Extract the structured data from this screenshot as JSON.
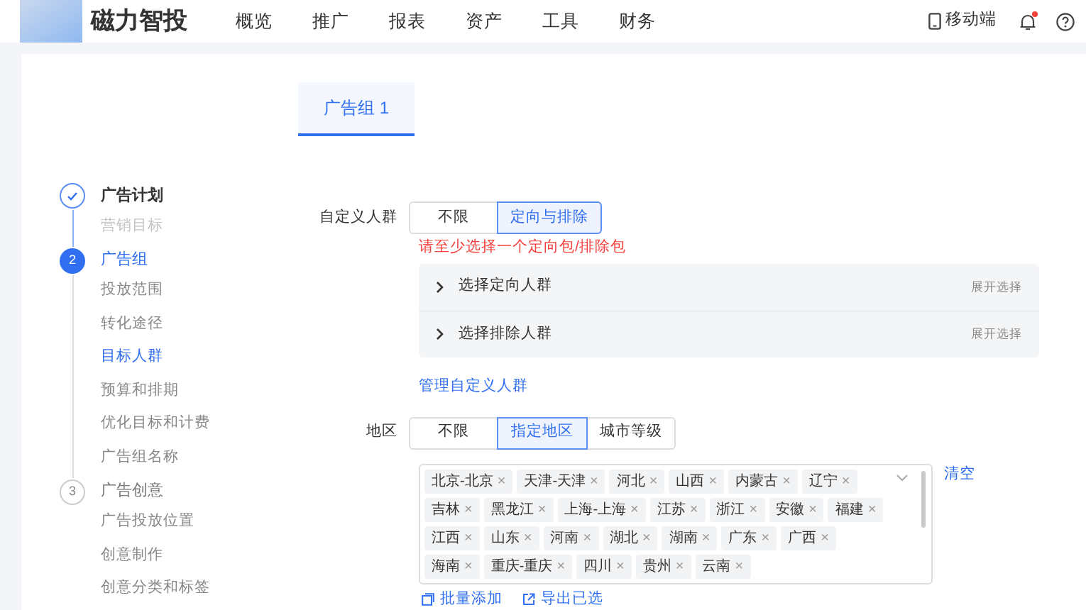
{
  "header": {
    "brand": "磁力智投",
    "nav": [
      "概览",
      "推广",
      "报表",
      "资产",
      "工具",
      "财务"
    ],
    "mobile": "移动端",
    "notification_dot": true
  },
  "tabs": [
    {
      "label": "广告组 1",
      "selected": true
    }
  ],
  "steps": [
    {
      "done": true,
      "current": false,
      "label": "广告计划",
      "children": [
        {
          "label": "营销目标",
          "selected": false,
          "disabled": true
        }
      ]
    },
    {
      "number": "2",
      "done": false,
      "current": true,
      "label": "广告组",
      "children": [
        {
          "label": "投放范围",
          "selected": false,
          "disabled": false
        },
        {
          "label": "转化途径",
          "selected": false,
          "disabled": false
        },
        {
          "label": "目标人群",
          "selected": true,
          "disabled": false
        },
        {
          "label": "预算和排期",
          "selected": false,
          "disabled": false
        },
        {
          "label": "优化目标和计费",
          "selected": false,
          "disabled": false
        },
        {
          "label": "广告组名称",
          "selected": false,
          "disabled": false
        }
      ]
    },
    {
      "number": "3",
      "done": false,
      "current": false,
      "label": "广告创意",
      "children": [
        {
          "label": "广告投放位置",
          "selected": false,
          "disabled": false
        },
        {
          "label": "创意制作",
          "selected": false,
          "disabled": false
        },
        {
          "label": "创意分类和标签",
          "selected": false,
          "disabled": false
        }
      ]
    }
  ],
  "custom_audience": {
    "label": "自定义人群",
    "options": [
      {
        "label": "不限",
        "selected": false
      },
      {
        "label": "定向与排除",
        "selected": true
      }
    ],
    "error": "请至少选择一个定向包/排除包",
    "panels": [
      {
        "title": "选择定向人群",
        "action": "展开选择"
      },
      {
        "title": "选择排除人群",
        "action": "展开选择"
      }
    ],
    "manage_link": "管理自定义人群"
  },
  "region": {
    "label": "地区",
    "options": [
      {
        "label": "不限",
        "selected": false
      },
      {
        "label": "指定地区",
        "selected": true
      },
      {
        "label": "城市等级",
        "selected": false
      }
    ],
    "tags": [
      "北京-北京",
      "天津-天津",
      "河北",
      "山西",
      "内蒙古",
      "辽宁",
      "吉林",
      "黑龙江",
      "上海-上海",
      "江苏",
      "浙江",
      "安徽",
      "福建",
      "江西",
      "山东",
      "河南",
      "湖北",
      "湖南",
      "广东",
      "广西",
      "海南",
      "重庆-重庆",
      "四川",
      "贵州",
      "云南"
    ],
    "tag_close": "×",
    "clear": "清空",
    "batch_add": "批量添加",
    "export": "导出已选"
  }
}
